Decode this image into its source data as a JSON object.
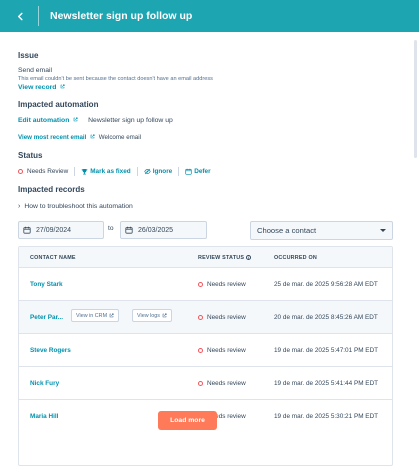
{
  "header": {
    "title": "Newsletter sign up follow up"
  },
  "issue": {
    "heading": "Issue",
    "type": "Send email",
    "description": "This email couldn't be sent because the contact doesn't have an email address",
    "view_record": "View record"
  },
  "impacted_automation": {
    "heading": "Impacted automation",
    "edit_label": "Edit automation",
    "automation_name": "Newsletter sign up follow up",
    "view_email_label": "View most recent email",
    "email_name": "Welcome email"
  },
  "status": {
    "heading": "Status",
    "current": "Needs Review",
    "actions": [
      "Mark as fixed",
      "Ignore",
      "Defer"
    ]
  },
  "impacted_records": {
    "heading": "Impacted records",
    "troubleshoot": "How to troubleshoot this automation"
  },
  "filters": {
    "start_date": "27/09/2024",
    "to_label": "to",
    "end_date": "26/03/2025",
    "contact_select": "Choose a contact"
  },
  "table": {
    "columns": [
      "CONTACT NAME",
      "REVIEW STATUS",
      "OCCURRED ON"
    ],
    "rows": [
      {
        "name": "Tony Stark",
        "status": "Needs review",
        "occurred": "25 de mar. de 2025 9:56:28 AM EDT"
      },
      {
        "name": "Peter Par...",
        "status": "Needs review",
        "occurred": "20 de mar. de 2025 8:45:26 AM EDT",
        "view_crm": "View in CRM",
        "view_logs": "View logs"
      },
      {
        "name": "Steve Rogers",
        "status": "Needs review",
        "occurred": "19 de mar. de 2025 5:47:01 PM EDT"
      },
      {
        "name": "Nick Fury",
        "status": "Needs review",
        "occurred": "19 de mar. de 2025 5:41:44 PM EDT"
      },
      {
        "name": "Maria Hill",
        "status": "Needs review",
        "occurred": "19 de mar. de 2025 5:30:21 PM EDT"
      }
    ]
  },
  "load_more": "Load more",
  "colors": {
    "header": "#1ea5b2",
    "link": "#0091ae",
    "primary_button": "#ff7a59",
    "status_dot": "#f2545b",
    "text": "#33475b"
  }
}
